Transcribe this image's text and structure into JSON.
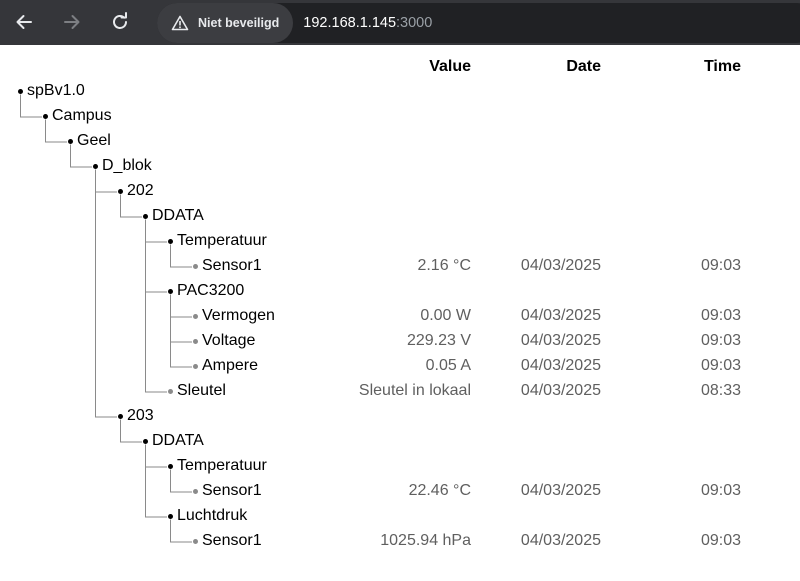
{
  "browser": {
    "security_label": "Niet beveiligd",
    "url_host": "192.168.1.145",
    "url_port": ":3000"
  },
  "columns": {
    "value": "Value",
    "date": "Date",
    "time": "Time"
  },
  "tree": [
    {
      "label": "spBv1.0",
      "depth": 0,
      "leaf": false
    },
    {
      "label": "Campus",
      "depth": 1,
      "leaf": false
    },
    {
      "label": "Geel",
      "depth": 2,
      "leaf": false
    },
    {
      "label": "D_blok",
      "depth": 3,
      "leaf": false
    },
    {
      "label": "202",
      "depth": 4,
      "leaf": false
    },
    {
      "label": "DDATA",
      "depth": 5,
      "leaf": false
    },
    {
      "label": "Temperatuur",
      "depth": 6,
      "leaf": false
    },
    {
      "label": "Sensor1",
      "depth": 7,
      "leaf": true,
      "value": "2.16 °C",
      "date": "04/03/2025",
      "time": "09:03"
    },
    {
      "label": "PAC3200",
      "depth": 6,
      "leaf": false
    },
    {
      "label": "Vermogen",
      "depth": 7,
      "leaf": true,
      "value": "0.00 W",
      "date": "04/03/2025",
      "time": "09:03"
    },
    {
      "label": "Voltage",
      "depth": 7,
      "leaf": true,
      "value": "229.23 V",
      "date": "04/03/2025",
      "time": "09:03"
    },
    {
      "label": "Ampere",
      "depth": 7,
      "leaf": true,
      "value": "0.05 A",
      "date": "04/03/2025",
      "time": "09:03"
    },
    {
      "label": "Sleutel",
      "depth": 6,
      "leaf": true,
      "value": "Sleutel in lokaal",
      "date": "04/03/2025",
      "time": "08:33"
    },
    {
      "label": "203",
      "depth": 4,
      "leaf": false
    },
    {
      "label": "DDATA",
      "depth": 5,
      "leaf": false
    },
    {
      "label": "Temperatuur",
      "depth": 6,
      "leaf": false
    },
    {
      "label": "Sensor1",
      "depth": 7,
      "leaf": true,
      "value": "22.46 °C",
      "date": "04/03/2025",
      "time": "09:03"
    },
    {
      "label": "Luchtdruk",
      "depth": 6,
      "leaf": false
    },
    {
      "label": "Sensor1",
      "depth": 7,
      "leaf": true,
      "value": "1025.94 hPa",
      "date": "04/03/2025",
      "time": "09:03"
    }
  ]
}
